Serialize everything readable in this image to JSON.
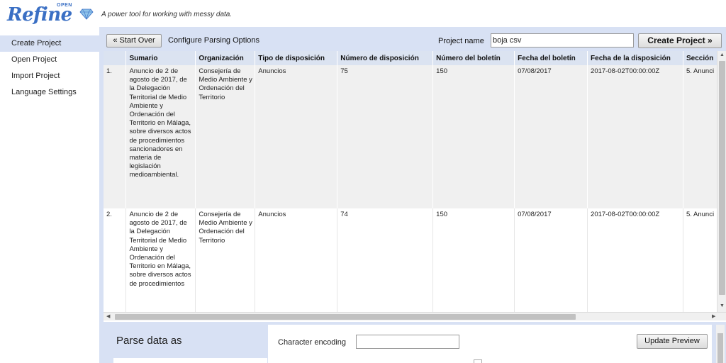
{
  "app": {
    "logo_text": "Refine",
    "logo_superscript": "OPEN",
    "tagline": "A power tool for working with messy data."
  },
  "nav": {
    "items": [
      {
        "label": "Create Project",
        "selected": true
      },
      {
        "label": "Open Project",
        "selected": false
      },
      {
        "label": "Import Project",
        "selected": false
      },
      {
        "label": "Language Settings",
        "selected": false
      }
    ]
  },
  "toolbar": {
    "start_over_label": "« Start Over",
    "configure_label": "Configure Parsing Options",
    "project_name_label": "Project name",
    "project_name_value": "boja csv",
    "create_project_label": "Create Project »"
  },
  "table": {
    "columns": [
      "",
      "Sumario",
      "Organización",
      "Tipo de disposición",
      "Número de disposición",
      "Número del boletín",
      "Fecha del boletín",
      "Fecha de la disposición",
      "Sección"
    ],
    "rows": [
      {
        "index": "1.",
        "sumario": "Anuncio de 2 de agosto de 2017, de la Delegación Territorial de Medio Ambiente y Ordenación del Territorio en Málaga, sobre diversos actos de procedimientos sancionadores en materia de legislación medioambiental.",
        "organizacion": "Consejería de Medio Ambiente y Ordenación del Territorio",
        "tipo": "Anuncios",
        "numero_disposicion": "75",
        "numero_boletin": "150",
        "fecha_boletin": "07/08/2017",
        "fecha_disposicion": "2017-08-02T00:00:00Z",
        "seccion": "5. Anunci"
      },
      {
        "index": "2.",
        "sumario": "Anuncio de 2 de agosto de 2017, de la Delegación Territorial de Medio Ambiente y Ordenación del Territorio en Málaga, sobre diversos actos de procedimientos",
        "organizacion": "Consejería de Medio Ambiente y Ordenación del Territorio",
        "tipo": "Anuncios",
        "numero_disposicion": "74",
        "numero_boletin": "150",
        "fecha_boletin": "07/08/2017",
        "fecha_disposicion": "2017-08-02T00:00:00Z",
        "seccion": "5. Anunci"
      }
    ]
  },
  "parse": {
    "title": "Parse data as",
    "encoding_label": "Character encoding",
    "encoding_value": "",
    "update_preview_label": "Update Preview"
  },
  "colors": {
    "brand": "#3a6fc4",
    "panel": "#d8e1f4",
    "header_row": "#dbe3f1",
    "odd_row": "#f0f0f0"
  }
}
